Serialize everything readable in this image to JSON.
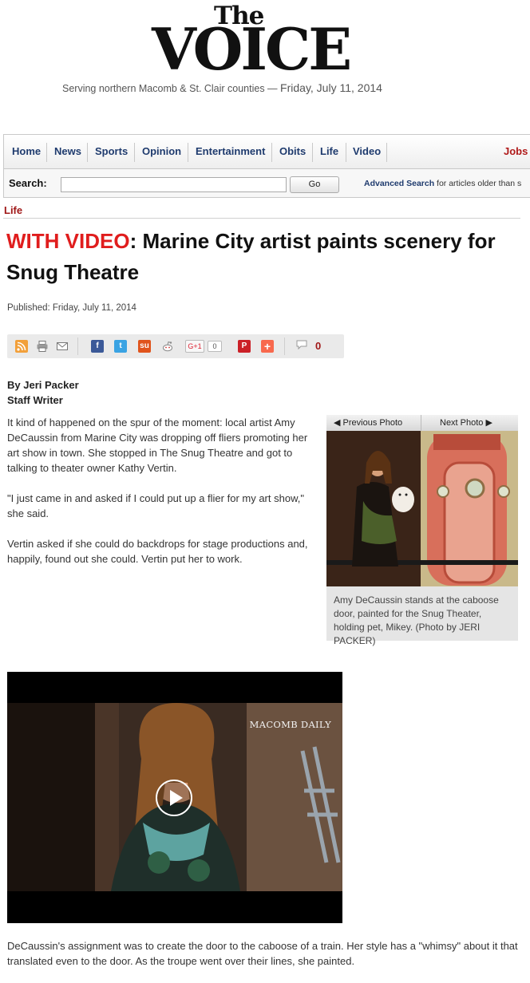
{
  "masthead": {
    "logo_the": "The",
    "logo_voice": "VOICE",
    "tagline": "Serving northern Macomb & St. Clair counties —",
    "date": "Friday, July 11, 2014"
  },
  "nav": {
    "items": [
      "Home",
      "News",
      "Sports",
      "Opinion",
      "Entertainment",
      "Obits",
      "Life",
      "Video"
    ],
    "jobs": "Jobs"
  },
  "search": {
    "label": "Search:",
    "value": "",
    "go": "Go",
    "advanced_link": "Advanced Search",
    "advanced_text": " for articles older than s"
  },
  "section": "Life",
  "article": {
    "headline_tag": "WITH VIDEO",
    "headline_rest": ": Marine City artist paints scenery for Snug Theatre",
    "published": "Published: Friday, July 11, 2014",
    "comment_count": "0",
    "share_icons": [
      "rss-icon",
      "print-icon",
      "email-icon",
      "facebook-icon",
      "twitter-icon",
      "stumbleupon-icon",
      "reddit-icon",
      "google-plus-icon",
      "pinterest-icon",
      "addthis-icon",
      "comment-icon"
    ],
    "google_plus_label": "G+1",
    "google_plus_count": "0",
    "author": "By Jeri Packer",
    "author_title": "Staff Writer",
    "paragraphs": [
      "It kind of happened on the spur of the moment: local artist Amy DeCaussin from Marine City was dropping off fliers promoting her art show in town. She stopped in The Snug Theatre and got to talking to theater owner Kathy Vertin.",
      "\"I just came in and asked if I could put up a flier for my art show,\" she said.",
      "Vertin asked if she could do backdrops for stage productions and, happily, found out she could. Vertin put her to work."
    ],
    "closing_paragraph": "DeCaussin's assignment was to create the door to the caboose of a train. Her style has a \"whimsy\" about it that translated even to the door. As the troupe went over their lines, she painted."
  },
  "photo": {
    "prev_label": "◀ Previous Photo",
    "next_label": "Next Photo ▶",
    "caption": "Amy DeCaussin stands at the caboose door, painted for the Snug Theater, holding pet, Mikey. (Photo by JERI PACKER)"
  },
  "video": {
    "watermark": "MACOMB DAILY"
  },
  "colors": {
    "nav_text": "#1f3b6e",
    "section_red": "#a01818",
    "headline_red": "#e01d1d"
  }
}
